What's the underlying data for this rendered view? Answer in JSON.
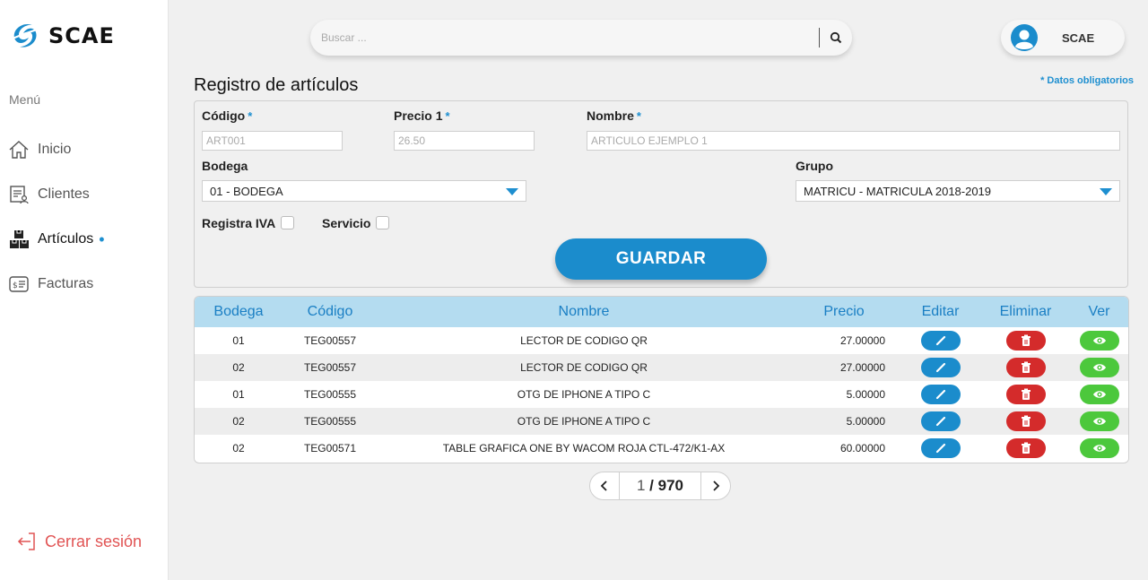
{
  "brand": {
    "name": "SCAE"
  },
  "sidebar": {
    "menu_label": "Menú",
    "items": [
      {
        "label": "Inicio",
        "icon": "home-icon"
      },
      {
        "label": "Clientes",
        "icon": "clients-icon"
      },
      {
        "label": "Artículos",
        "icon": "boxes-icon",
        "active": true
      },
      {
        "label": "Facturas",
        "icon": "invoice-icon"
      }
    ],
    "active_marker": "•",
    "logout_label": "Cerrar sesión"
  },
  "header": {
    "search_placeholder": "Buscar ...",
    "user_name": "SCAE"
  },
  "form": {
    "title": "Registro de artículos",
    "required_note": "* Datos obligatorios",
    "codigo_label": "Código",
    "codigo_placeholder": "ART001",
    "precio_label": "Precio 1",
    "precio_placeholder": "26.50",
    "nombre_label": "Nombre",
    "nombre_placeholder": "ARTICULO EJEMPLO 1",
    "required_star": "*",
    "bodega_label": "Bodega",
    "bodega_value": "01 - BODEGA",
    "grupo_label": "Grupo",
    "grupo_value": "MATRICU - MATRICULA 2018-2019",
    "iva_label": "Registra IVA",
    "servicio_label": "Servicio",
    "save_label": "GUARDAR"
  },
  "table": {
    "headers": [
      "Bodega",
      "Código",
      "Nombre",
      "Precio",
      "Editar",
      "Eliminar",
      "Ver"
    ],
    "rows": [
      {
        "bodega": "01",
        "codigo": "TEG00557",
        "nombre": "LECTOR DE CODIGO QR",
        "precio": "27.00000"
      },
      {
        "bodega": "02",
        "codigo": "TEG00557",
        "nombre": "LECTOR DE CODIGO QR",
        "precio": "27.00000"
      },
      {
        "bodega": "01",
        "codigo": "TEG00555",
        "nombre": "OTG DE IPHONE A TIPO C",
        "precio": "5.00000"
      },
      {
        "bodega": "02",
        "codigo": "TEG00555",
        "nombre": "OTG DE IPHONE A TIPO C",
        "precio": "5.00000"
      },
      {
        "bodega": "02",
        "codigo": "TEG00571",
        "nombre": "TABLE GRAFICA ONE BY WACOM ROJA CTL-472/K1-AX",
        "precio": "60.00000"
      }
    ]
  },
  "pagination": {
    "current": "1",
    "separator": "/",
    "total": "970"
  },
  "colors": {
    "accent": "#1b8ccc",
    "header_bg": "#b4dcf0",
    "danger": "#d42b2b",
    "success": "#4cc83c",
    "logout": "#e15454"
  }
}
